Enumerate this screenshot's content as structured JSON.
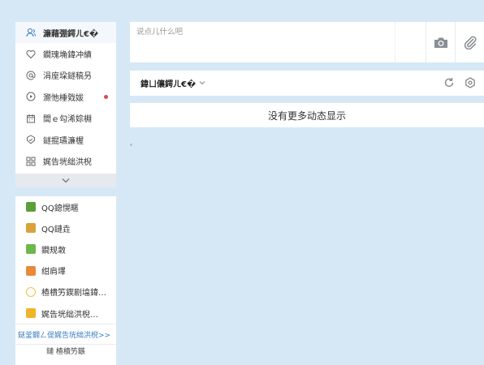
{
  "sidebar": {
    "items": [
      {
        "label": "濂藉弸鍔ㄦ€�",
        "icon": "friends-icon",
        "active": true
      },
      {
        "label": "鐗瑰埆鍏冲績",
        "icon": "heart-icon"
      },
      {
        "label": "涓庢垜鐩稿叧",
        "icon": "at-icon"
      },
      {
        "label": "灏忚棰戣妭",
        "icon": "video-icon",
        "badge": "red-dot"
      },
      {
        "label": "閭ｅ勾浠婃棩",
        "icon": "calendar-icon"
      },
      {
        "label": "鐩掍瓙濂楃",
        "icon": "shield-icon"
      },
      {
        "label": "娓告垙绌洪棿",
        "icon": "grid-icon"
      }
    ],
    "expand_icon": "chevron-down-icon",
    "apps": [
      {
        "label": "QQ鎴愰暱",
        "color": "#5a9f3a"
      },
      {
        "label": "QQ鏈垚",
        "color": "#d8a43a"
      },
      {
        "label": "鐗规敹",
        "color": "#6cb84a"
      },
      {
        "label": "绀肩墿",
        "color": "#e88a3a"
      },
      {
        "label": "楂樻竻鍥剧墖鍏…",
        "color": "#f2c14a"
      },
      {
        "label": "娓告垙绌洪棿…",
        "color": "#f0b429"
      }
    ],
    "more_link": "鎹釜鐗ㄥ偍娓告垙绌洪棿>>",
    "footer": "鏈  楂樻竻鏃"
  },
  "composer": {
    "placeholder": "说点儿什么吧",
    "camera_icon": "camera-icon",
    "attach_icon": "paperclip-icon"
  },
  "filter": {
    "title": "鍏ㄩ儴鍔ㄦ€�",
    "dropdown_icon": "chevron-down-icon",
    "refresh_icon": "refresh-icon",
    "settings_icon": "settings-icon"
  },
  "feed": {
    "no_more": "没有更多动态显示"
  },
  "colors": {
    "background": "#d6e8f6",
    "card": "#ffffff",
    "accent": "#3a7cc4",
    "badge": "#e04848"
  }
}
